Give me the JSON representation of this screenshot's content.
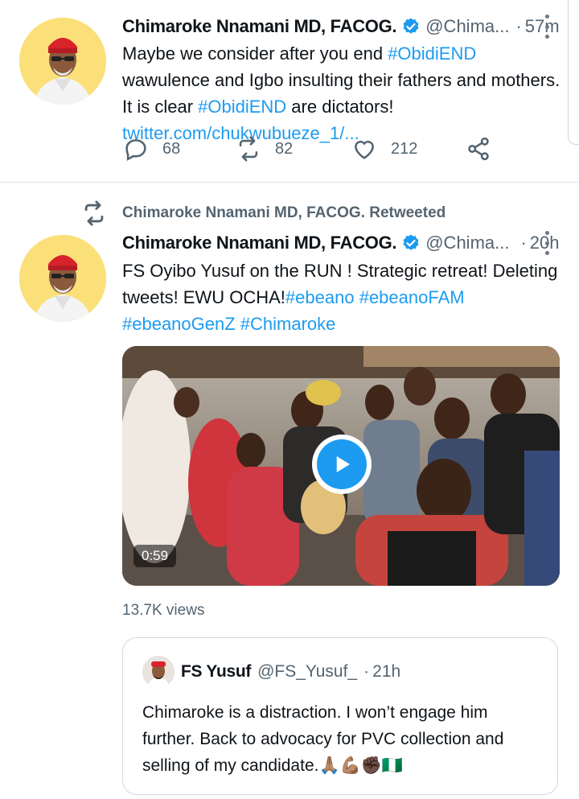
{
  "tweet1": {
    "name": "Chimaroke Nnamani MD, FACOG.",
    "handle": "@Chima...",
    "time": "57m",
    "text_parts": [
      {
        "t": "Maybe we consider after you end ",
        "link": false
      },
      {
        "t": "#ObidiEND",
        "link": true
      },
      {
        "t": " wawulence and Igbo insulting their fathers and mothers. It is clear ",
        "link": false
      },
      {
        "t": "#ObidiEND",
        "link": true
      },
      {
        "t": " are dictators! ",
        "link": false
      },
      {
        "t": "twitter.com/chukwubueze_1/...",
        "link": true
      }
    ],
    "replies": "68",
    "retweets": "82",
    "likes": "212"
  },
  "tweet2": {
    "retweet_label": "Chimaroke Nnamani MD, FACOG. Retweeted",
    "name": "Chimaroke Nnamani MD, FACOG.",
    "handle": "@Chima...",
    "time": "20h",
    "text_parts": [
      {
        "t": "FS Oyibo Yusuf on the RUN ! Strategic retreat! Deleting tweets! EWU OCHA!",
        "link": false
      },
      {
        "t": "#ebeano",
        "link": true
      },
      {
        "t": "  ",
        "link": false
      },
      {
        "t": "#ebeanoFAM",
        "link": true
      },
      {
        "t": " ",
        "link": false
      },
      {
        "t": "#ebeanoGenZ",
        "link": true
      },
      {
        "t": " ",
        "link": false
      },
      {
        "t": "#Chimaroke",
        "link": true
      }
    ],
    "video_duration": "0:59",
    "views": "13.7K views",
    "quoted": {
      "name": "FS Yusuf",
      "handle": "@FS_Yusuf_",
      "time": "21h",
      "text": "Chimaroke is a distraction. I won’t engage him further. Back to advocacy for PVC collection and selling of my candidate.🙏🏽💪🏽✊🏿🇳🇬"
    }
  },
  "colors": {
    "accent": "#1d9bf0",
    "muted": "#536471",
    "text": "#0f1419"
  },
  "icons": {
    "reply": "reply-icon",
    "retweet": "retweet-icon",
    "like": "heart-icon",
    "share": "share-icon",
    "verified": "verified-badge-icon",
    "more": "more-options-icon",
    "play": "play-icon"
  }
}
